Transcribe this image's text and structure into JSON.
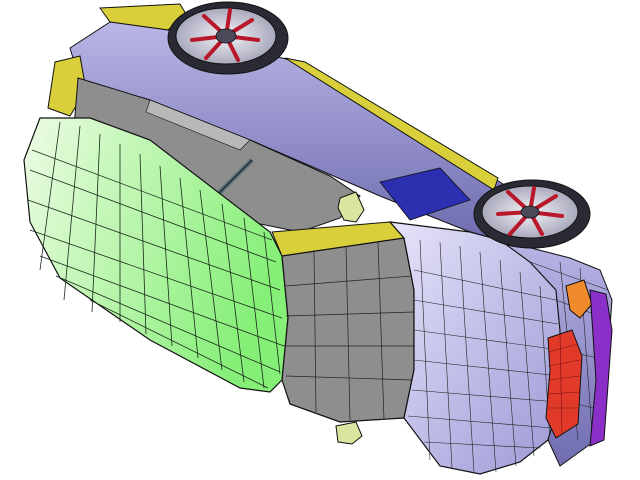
{
  "viewport": {
    "background": "#ffffff",
    "content": "fe-mesh-car-model-upside-down"
  },
  "colors": {
    "mesh_line": "#111111",
    "body_panel": "#c9c6ee",
    "body_panel_dark": "#8f8cc8",
    "roof_panel": "#aaf5a0",
    "roof_highlight": "#eefce6",
    "glass": "#8e8e8e",
    "glass_light": "#b8b8b8",
    "trim": "#d9cf3a",
    "trim_dark": "#b3a520",
    "blue_strip": "#2b2fb0",
    "tail_light": "#e23a2a",
    "orange_light": "#f08a2a",
    "purple_trim": "#8a2fc8",
    "wheel_rim": "#d9d9e6",
    "wheel_spoke_red": "#b8182a",
    "wheel_tire": "#2a2a35",
    "mirror": "#d8e6a0"
  }
}
